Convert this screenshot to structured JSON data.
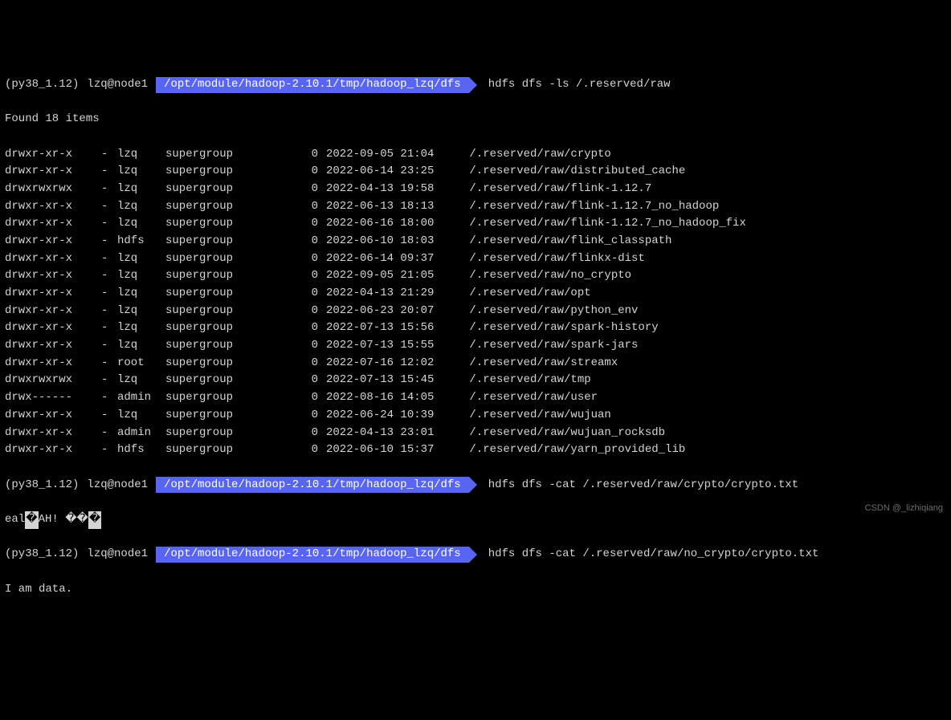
{
  "prompt1": {
    "env": "(py38_1.12)",
    "user_host": "lzq@node1",
    "path": "/opt/module/hadoop-2.10.1/tmp/hadoop_lzq/dfs",
    "cmd": "hdfs dfs -ls /.reserved/raw"
  },
  "found_line": "Found 18 items",
  "listing": [
    {
      "perm": "drwxr-xr-x",
      "dash": "-",
      "owner": "lzq",
      "group": "supergroup",
      "size": "0",
      "date": "2022-09-05 21:04",
      "name": "/.reserved/raw/crypto"
    },
    {
      "perm": "drwxr-xr-x",
      "dash": "-",
      "owner": "lzq",
      "group": "supergroup",
      "size": "0",
      "date": "2022-06-14 23:25",
      "name": "/.reserved/raw/distributed_cache"
    },
    {
      "perm": "drwxrwxrwx",
      "dash": "-",
      "owner": "lzq",
      "group": "supergroup",
      "size": "0",
      "date": "2022-04-13 19:58",
      "name": "/.reserved/raw/flink-1.12.7"
    },
    {
      "perm": "drwxr-xr-x",
      "dash": "-",
      "owner": "lzq",
      "group": "supergroup",
      "size": "0",
      "date": "2022-06-13 18:13",
      "name": "/.reserved/raw/flink-1.12.7_no_hadoop"
    },
    {
      "perm": "drwxr-xr-x",
      "dash": "-",
      "owner": "lzq",
      "group": "supergroup",
      "size": "0",
      "date": "2022-06-16 18:00",
      "name": "/.reserved/raw/flink-1.12.7_no_hadoop_fix"
    },
    {
      "perm": "drwxr-xr-x",
      "dash": "-",
      "owner": "hdfs",
      "group": "supergroup",
      "size": "0",
      "date": "2022-06-10 18:03",
      "name": "/.reserved/raw/flink_classpath"
    },
    {
      "perm": "drwxr-xr-x",
      "dash": "-",
      "owner": "lzq",
      "group": "supergroup",
      "size": "0",
      "date": "2022-06-14 09:37",
      "name": "/.reserved/raw/flinkx-dist"
    },
    {
      "perm": "drwxr-xr-x",
      "dash": "-",
      "owner": "lzq",
      "group": "supergroup",
      "size": "0",
      "date": "2022-09-05 21:05",
      "name": "/.reserved/raw/no_crypto"
    },
    {
      "perm": "drwxr-xr-x",
      "dash": "-",
      "owner": "lzq",
      "group": "supergroup",
      "size": "0",
      "date": "2022-04-13 21:29",
      "name": "/.reserved/raw/opt"
    },
    {
      "perm": "drwxr-xr-x",
      "dash": "-",
      "owner": "lzq",
      "group": "supergroup",
      "size": "0",
      "date": "2022-06-23 20:07",
      "name": "/.reserved/raw/python_env"
    },
    {
      "perm": "drwxr-xr-x",
      "dash": "-",
      "owner": "lzq",
      "group": "supergroup",
      "size": "0",
      "date": "2022-07-13 15:56",
      "name": "/.reserved/raw/spark-history"
    },
    {
      "perm": "drwxr-xr-x",
      "dash": "-",
      "owner": "lzq",
      "group": "supergroup",
      "size": "0",
      "date": "2022-07-13 15:55",
      "name": "/.reserved/raw/spark-jars"
    },
    {
      "perm": "drwxr-xr-x",
      "dash": "-",
      "owner": "root",
      "group": "supergroup",
      "size": "0",
      "date": "2022-07-16 12:02",
      "name": "/.reserved/raw/streamx"
    },
    {
      "perm": "drwxrwxrwx",
      "dash": "-",
      "owner": "lzq",
      "group": "supergroup",
      "size": "0",
      "date": "2022-07-13 15:45",
      "name": "/.reserved/raw/tmp"
    },
    {
      "perm": "drwx------",
      "dash": "-",
      "owner": "admin",
      "group": "supergroup",
      "size": "0",
      "date": "2022-08-16 14:05",
      "name": "/.reserved/raw/user"
    },
    {
      "perm": "drwxr-xr-x",
      "dash": "-",
      "owner": "lzq",
      "group": "supergroup",
      "size": "0",
      "date": "2022-06-24 10:39",
      "name": "/.reserved/raw/wujuan"
    },
    {
      "perm": "drwxr-xr-x",
      "dash": "-",
      "owner": "admin",
      "group": "supergroup",
      "size": "0",
      "date": "2022-04-13 23:01",
      "name": "/.reserved/raw/wujuan_rocksdb"
    },
    {
      "perm": "drwxr-xr-x",
      "dash": "-",
      "owner": "hdfs",
      "group": "supergroup",
      "size": "0",
      "date": "2022-06-10 15:37",
      "name": "/.reserved/raw/yarn_provided_lib"
    }
  ],
  "prompt2": {
    "env": "(py38_1.12)",
    "user_host": "lzq@node1",
    "path": "/opt/module/hadoop-2.10.1/tmp/hadoop_lzq/dfs",
    "cmd": "hdfs dfs -cat /.reserved/raw/crypto/crypto.txt"
  },
  "garbled": {
    "p1": "eal",
    "blk": "�",
    "p2": "AH! ",
    "p3": "��",
    "blk2": "�"
  },
  "prompt3": {
    "env": "(py38_1.12)",
    "user_host": "lzq@node1",
    "path": "/opt/module/hadoop-2.10.1/tmp/hadoop_lzq/dfs",
    "cmd": "hdfs dfs -cat /.reserved/raw/no_crypto/crypto.txt"
  },
  "output3": "I am data.",
  "watermark": "CSDN @_lizhiqiang"
}
